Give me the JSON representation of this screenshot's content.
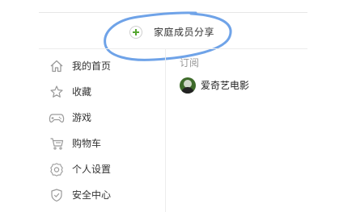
{
  "header": {
    "family_share_label": "家庭成员分享"
  },
  "sidebar": {
    "items": [
      {
        "label": "我的首页",
        "icon": "home-icon"
      },
      {
        "label": "收藏",
        "icon": "star-icon"
      },
      {
        "label": "游戏",
        "icon": "gamepad-icon"
      },
      {
        "label": "购物车",
        "icon": "cart-icon"
      },
      {
        "label": "个人设置",
        "icon": "gear-icon"
      },
      {
        "label": "安全中心",
        "icon": "shield-icon"
      }
    ]
  },
  "subscriptions": {
    "title": "订阅",
    "items": [
      {
        "name": "爱奇艺电影"
      }
    ]
  },
  "colors": {
    "accent_green": "#55a630",
    "annotation_blue": "#6fa3e8",
    "icon_gray": "#9a9a9a"
  }
}
